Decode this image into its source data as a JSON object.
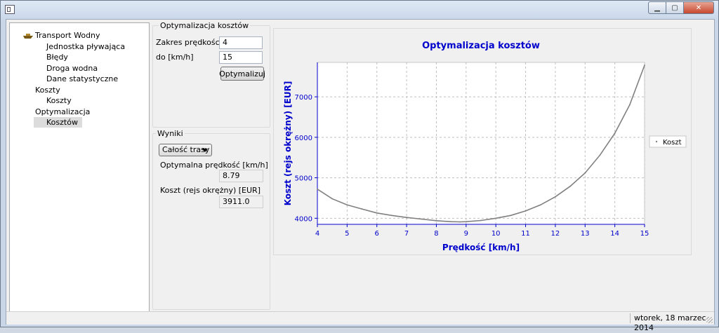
{
  "window": {
    "title": ""
  },
  "tree": {
    "items": [
      {
        "label": "Transport Wodny",
        "level": 0,
        "icon": "boat-icon"
      },
      {
        "label": "Jednostka pływająca",
        "level": 2
      },
      {
        "label": "Błędy",
        "level": 2
      },
      {
        "label": "Droga wodna",
        "level": 2
      },
      {
        "label": "Dane statystyczne",
        "level": 2
      },
      {
        "label": "Koszty",
        "level": 1
      },
      {
        "label": "Koszty",
        "level": 2
      },
      {
        "label": "Optymalizacja",
        "level": 1
      },
      {
        "label": "Kosztów",
        "level": 2,
        "selected": true
      }
    ]
  },
  "optimization": {
    "group_title": "Optymalizacja kosztów",
    "range_from_label": "Zakres prędkości od",
    "range_from_value": "4",
    "range_to_label": "do [km/h]",
    "range_to_value": "15",
    "optimize_button": "Optymalizuj"
  },
  "results": {
    "group_title": "Wyniki",
    "scope_selected": "Całość trasy",
    "optimal_speed_label": "Optymalna prędkość [km/h]",
    "optimal_speed_value": "8.79",
    "cost_label": "Koszt (rejs okrężny) [EUR]",
    "cost_value": "3911.0"
  },
  "status": {
    "date": "wtorek, 18 marzec 2014"
  },
  "colors": {
    "axis": "#0000cc",
    "title": "#0000cc",
    "series": "#808080"
  },
  "chart_data": {
    "type": "line",
    "title": "Optymalizacja kosztów",
    "xlabel": "Prędkość [km/h]",
    "ylabel": "Koszt (rejs okrężny) [EUR]",
    "xlim": [
      4,
      15
    ],
    "ylim": [
      3850,
      7850
    ],
    "x_ticks": [
      4,
      5,
      6,
      7,
      8,
      9,
      10,
      11,
      12,
      13,
      14,
      15
    ],
    "y_ticks": [
      4000,
      5000,
      6000,
      7000
    ],
    "x_tick_labels": [
      "4",
      "5",
      "6",
      "7",
      "8",
      "9",
      "10",
      "11",
      "12",
      "13",
      "14",
      "15"
    ],
    "y_tick_labels": [
      "4000",
      "5000",
      "6000",
      "7000"
    ],
    "grid": true,
    "legend": "right",
    "series": [
      {
        "name": "Koszt",
        "x": [
          4,
          4.5,
          5,
          5.5,
          6,
          6.5,
          7,
          7.5,
          8,
          8.5,
          8.79,
          9,
          9.5,
          10,
          10.5,
          11,
          11.5,
          12,
          12.5,
          13,
          13.5,
          14,
          14.5,
          15
        ],
        "y": [
          4720,
          4480,
          4330,
          4230,
          4130,
          4070,
          4020,
          3980,
          3940,
          3915,
          3911,
          3915,
          3945,
          4000,
          4070,
          4180,
          4330,
          4530,
          4790,
          5120,
          5560,
          6100,
          6800,
          7780
        ]
      }
    ]
  }
}
